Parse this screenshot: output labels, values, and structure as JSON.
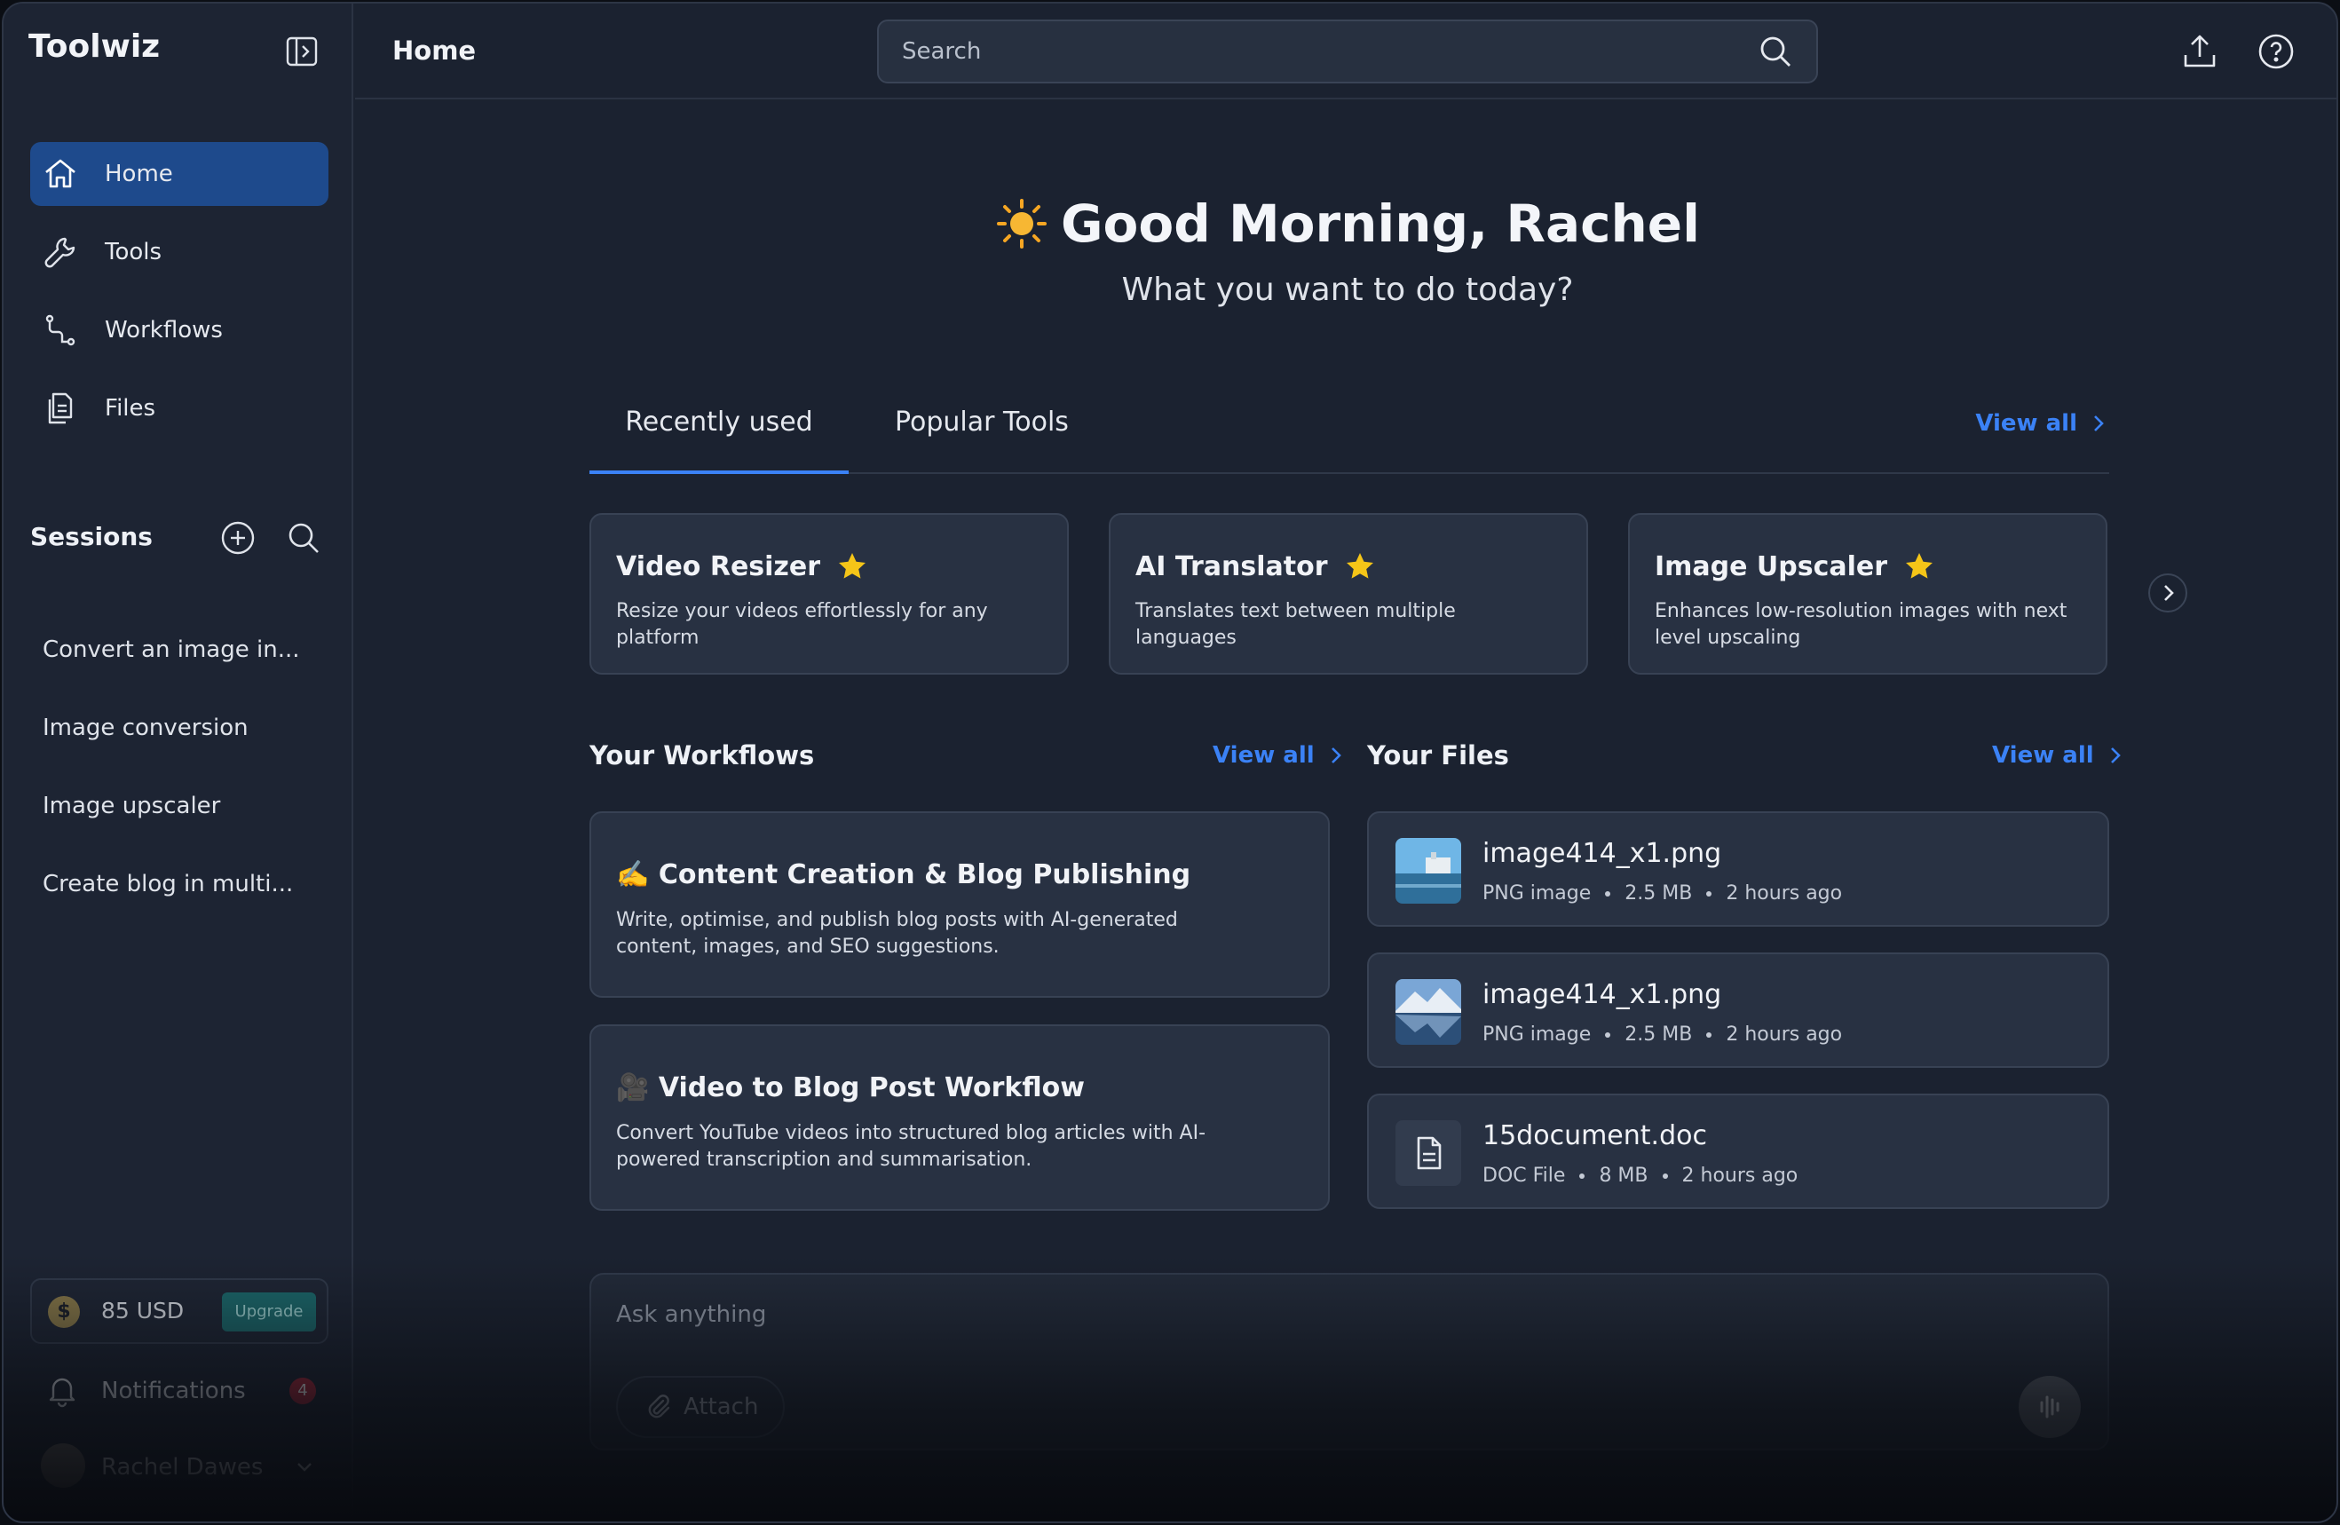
{
  "app": {
    "brand": "Toolwiz"
  },
  "sidebar": {
    "nav": [
      {
        "label": "Home",
        "icon": "home-icon",
        "active": true
      },
      {
        "label": "Tools",
        "icon": "wrench-icon"
      },
      {
        "label": "Workflows",
        "icon": "workflow-icon"
      },
      {
        "label": "Files",
        "icon": "files-icon"
      }
    ],
    "sessions_title": "Sessions",
    "sessions": [
      "Convert an image in...",
      "Image conversion",
      "Image upscaler",
      "Create blog in multi..."
    ],
    "credit": {
      "amount": "85 USD",
      "upgrade_label": "Upgrade"
    },
    "notifications": {
      "label": "Notifications",
      "count": "4"
    },
    "user": {
      "name": "Rachel Dawes"
    }
  },
  "topbar": {
    "title": "Home",
    "search_placeholder": "Search"
  },
  "greeting": {
    "title": "Good Morning, Rachel",
    "subtitle": "What you want to do today?"
  },
  "tabs": {
    "items": [
      "Recently used",
      "Popular Tools"
    ],
    "active": 0,
    "view_all": "View all"
  },
  "tools": [
    {
      "title": "Video Resizer",
      "desc": "Resize your videos effortlessly for any platform"
    },
    {
      "title": "AI Translator",
      "desc": "Translates text between multiple languages"
    },
    {
      "title": "Image Upscaler",
      "desc": "Enhances low-resolution images with next level upscaling"
    }
  ],
  "workflows": {
    "title": "Your Workflows",
    "view_all": "View all",
    "items": [
      {
        "emoji": "✍️",
        "title": "Content Creation & Blog Publishing",
        "desc": "Write, optimise, and publish blog posts with AI-generated content, images, and SEO suggestions."
      },
      {
        "emoji": "🎥",
        "title": "Video to Blog Post Workflow",
        "desc": "Convert YouTube videos into structured blog articles with AI-powered transcription and summarisation."
      }
    ]
  },
  "files": {
    "title": "Your Files",
    "view_all": "View all",
    "items": [
      {
        "name": "image414_x1.png",
        "type": "PNG image",
        "size": "2.5 MB",
        "time": "2 hours ago"
      },
      {
        "name": "image414_x1.png",
        "type": "PNG image",
        "size": "2.5 MB",
        "time": "2 hours ago"
      },
      {
        "name": "15document.doc",
        "type": "DOC File",
        "size": "8 MB",
        "time": "2 hours ago"
      }
    ]
  },
  "ask": {
    "placeholder": "Ask anything",
    "attach_label": "Attach"
  },
  "colors": {
    "accent": "#3b82f6",
    "active_nav": "#1e4a8c",
    "star": "#f5c518",
    "background": "#1b2230"
  }
}
